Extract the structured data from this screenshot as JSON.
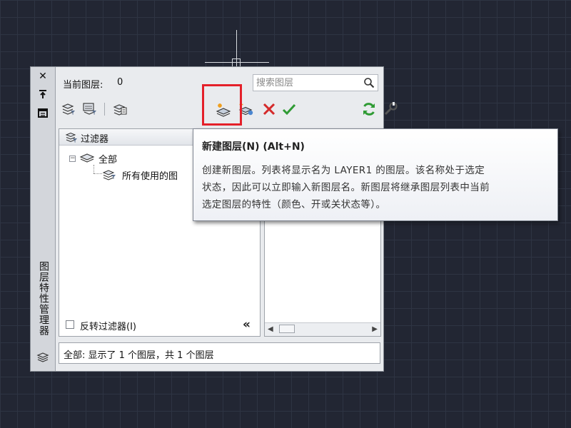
{
  "palette": {
    "title": "图层特性管理器",
    "current_layer_label": "当前图层:",
    "current_layer_value": "0",
    "search_placeholder": "搜索图层"
  },
  "filter_tree": {
    "header": "过滤器",
    "root_label": "全部",
    "child_label": "所有使用的图",
    "invert_filter_label": "反转过滤器(I)",
    "collapse_glyph": "«"
  },
  "status": {
    "text": "全部: 显示了 1 个图层，共 1 个图层"
  },
  "tooltip": {
    "title": "新建图层(N) (Alt+N)",
    "line1": "创建新图层。列表将显示名为 LAYER1 的图层。该名称处于选定",
    "line2": "状态，因此可以立即输入新图层名。新图层将继承图层列表中当前",
    "line3": "选定图层的特性（颜色、开或关状态等）。"
  },
  "colors": {
    "highlight": "#e4202a",
    "delete_icon": "#d42a2a",
    "check_icon": "#2f9b34",
    "refresh_icon": "#2f9b34"
  },
  "icons": [
    "close-icon",
    "autohide-icon",
    "properties-icon",
    "new-property-filter-icon",
    "new-group-filter-icon",
    "layer-states-icon",
    "new-layer-icon",
    "new-layer-frozen-icon",
    "delete-layer-icon",
    "set-current-icon",
    "refresh-icon",
    "settings-icon",
    "search-icon",
    "layer-stack-icon"
  ]
}
